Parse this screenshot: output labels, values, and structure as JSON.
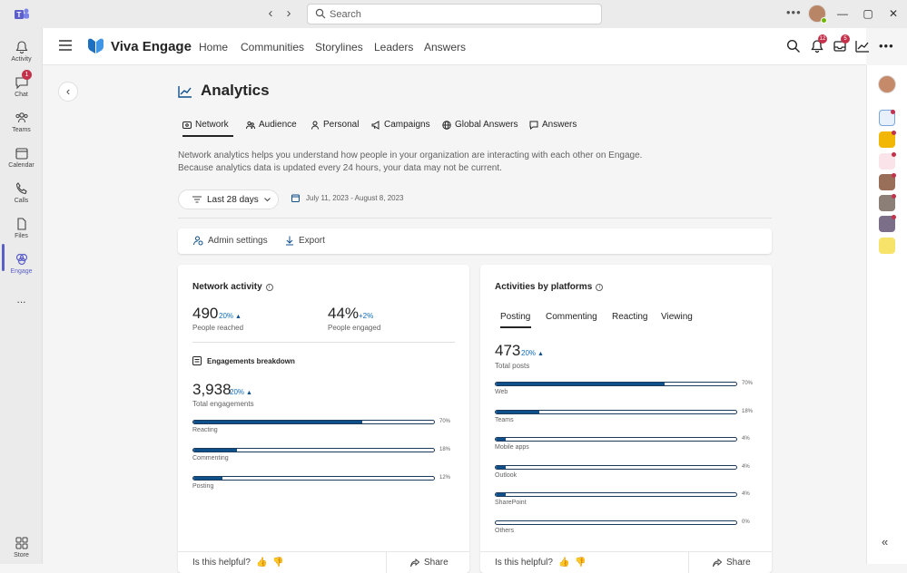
{
  "window": {
    "search_placeholder": "Search"
  },
  "rail": {
    "items": [
      {
        "label": "Activity",
        "icon": "bell-icon"
      },
      {
        "label": "Chat",
        "icon": "chat-icon",
        "badge": "1"
      },
      {
        "label": "Teams",
        "icon": "teams-icon"
      },
      {
        "label": "Calendar",
        "icon": "calendar-icon"
      },
      {
        "label": "Calls",
        "icon": "phone-icon"
      },
      {
        "label": "Files",
        "icon": "file-icon"
      },
      {
        "label": "Engage",
        "icon": "engage-icon"
      }
    ],
    "more": "...",
    "store_label": "Store"
  },
  "appbar": {
    "app_name": "Viva Engage",
    "nav": [
      "Home",
      "Communities",
      "Storylines",
      "Leaders",
      "Answers"
    ],
    "notification_badge": "12",
    "inbox_badge": "5"
  },
  "page": {
    "title": "Analytics",
    "tabs": [
      "Network",
      "Audience",
      "Personal",
      "Campaigns",
      "Global Answers",
      "Answers"
    ],
    "active_tab": "Network",
    "description_line1": "Network analytics helps you understand how people in your organization are interacting with each other on Engage.",
    "description_line2": "Because analytics data is updated every 24 hours, your data may not be current.",
    "range_label": "Last 28 days",
    "date_range": "July 11, 2023 - August 8, 2023",
    "admin_settings": "Admin settings",
    "export": "Export"
  },
  "network_card": {
    "title": "Network activity",
    "reached_value": "490",
    "reached_change": "20%",
    "reached_label": "People reached",
    "engaged_value": "44%",
    "engaged_change": "+2%",
    "engaged_label": "People engaged",
    "breakdown_title": "Engagements breakdown",
    "total_value": "3,938",
    "total_change": "20%",
    "total_label": "Total engagements",
    "bars": [
      {
        "label": "Reacting",
        "value": "70%",
        "fraction": 0.7
      },
      {
        "label": "Commenting",
        "value": "18%",
        "fraction": 0.18
      },
      {
        "label": "Posting",
        "value": "12%",
        "fraction": 0.12
      }
    ],
    "helpful": "Is this helpful?",
    "share": "Share"
  },
  "platform_card": {
    "title": "Activities by platforms",
    "tabs": [
      "Posting",
      "Commenting",
      "Reacting",
      "Viewing"
    ],
    "active_tab": "Posting",
    "total_value": "473",
    "total_change": "20%",
    "total_label": "Total posts",
    "bars": [
      {
        "label": "Web",
        "value": "70%",
        "fraction": 0.7
      },
      {
        "label": "Teams",
        "value": "18%",
        "fraction": 0.18
      },
      {
        "label": "Mobile apps",
        "value": "4%",
        "fraction": 0.04
      },
      {
        "label": "Outlook",
        "value": "4%",
        "fraction": 0.04
      },
      {
        "label": "SharePoint",
        "value": "4%",
        "fraction": 0.04
      },
      {
        "label": "Others",
        "value": "0%",
        "fraction": 0.0
      }
    ],
    "helpful": "Is this helpful?",
    "share": "Share"
  },
  "colors": {
    "accent": "#5b5fc7",
    "bar_fill": "#0f4f8a",
    "change_blue": "#0f6cbd",
    "badge_red": "#c4314b"
  }
}
